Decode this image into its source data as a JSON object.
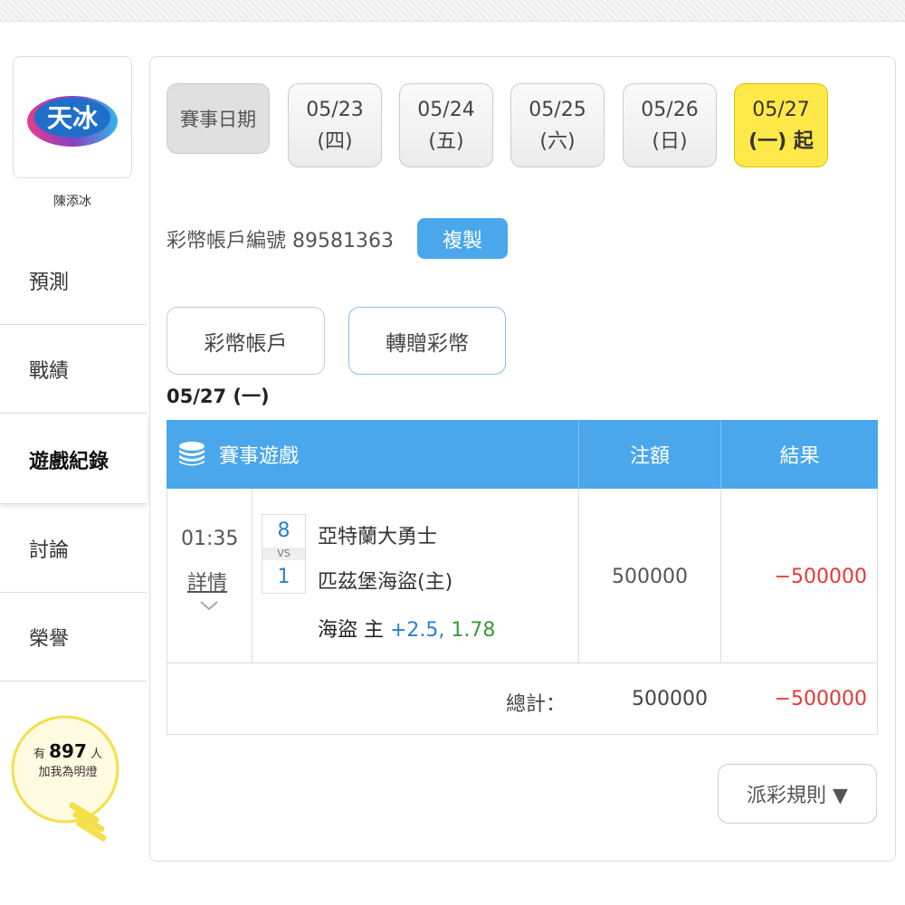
{
  "sidebar": {
    "logo_text": "天冰",
    "username": "陳添冰",
    "nav": [
      {
        "label": "預測"
      },
      {
        "label": "戰績"
      },
      {
        "label": "遊戲紀錄"
      },
      {
        "label": "討論"
      },
      {
        "label": "榮譽"
      }
    ],
    "lamp": {
      "prefix": "有",
      "count": "897",
      "suffix": "人",
      "line2": "加我為明燈"
    }
  },
  "dates": {
    "label": "賽事日期",
    "items": [
      {
        "date": "05/23",
        "day": "(四)"
      },
      {
        "date": "05/24",
        "day": "(五)"
      },
      {
        "date": "05/25",
        "day": "(六)"
      },
      {
        "date": "05/26",
        "day": "(日)"
      },
      {
        "date": "05/27",
        "day": "(一) 起"
      }
    ]
  },
  "account": {
    "label": "彩幣帳戶編號 89581363",
    "copy_label": "複製"
  },
  "tabs": [
    {
      "label": "彩幣帳戶"
    },
    {
      "label": "轉贈彩幣"
    }
  ],
  "date_heading": "05/27 (一)",
  "table": {
    "headers": {
      "game": "賽事遊戲",
      "amount": "注額",
      "result": "結果"
    },
    "row": {
      "time": "01:35",
      "detail": "詳情",
      "score_away": "8",
      "vs": "VS",
      "score_home": "1",
      "team_away": "亞特蘭大勇士",
      "team_home": "匹茲堡海盜(主)",
      "pick": "海盜 主",
      "handicap": "+2.5,",
      "odds": "1.78",
      "amount": "500000",
      "result": "−500000"
    },
    "total_label": "總計：",
    "total_amount": "500000",
    "total_result": "−500000"
  },
  "rules_button": "派彩規則 ▼",
  "colors": {
    "accent": "#4aa7ec",
    "selected_date": "#ffe84a",
    "loss": "#e53935",
    "handicap": "#2a7fd4",
    "odds": "#3a9a3a"
  }
}
